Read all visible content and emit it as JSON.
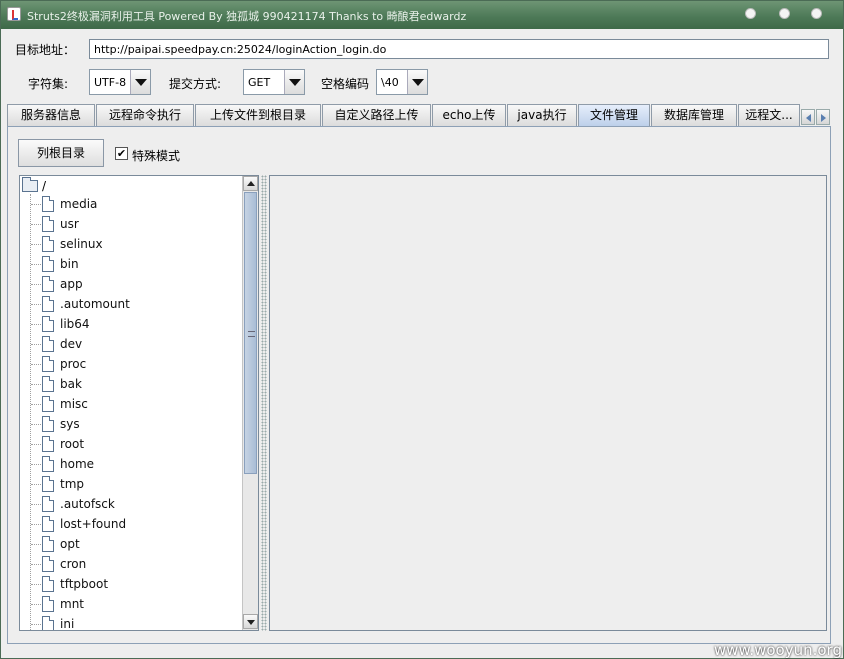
{
  "window": {
    "title": "Struts2终极漏洞利用工具   Powered By 独孤城 990421174 Thanks to 畸酿君edwardz"
  },
  "target": {
    "label": "目标地址：",
    "url": "http://paipai.speedpay.cn:25024/loginAction_login.do"
  },
  "options": {
    "charset_label": "字符集:",
    "charset_value": "UTF-8",
    "method_label": "提交方式:",
    "method_value": "GET",
    "space_label": "空格编码",
    "space_value": "\\40"
  },
  "tabs": [
    {
      "label": "服务器信息"
    },
    {
      "label": "远程命令执行"
    },
    {
      "label": "上传文件到根目录"
    },
    {
      "label": "自定义路径上传"
    },
    {
      "label": "echo上传"
    },
    {
      "label": "java执行"
    },
    {
      "label": "文件管理",
      "active": true
    },
    {
      "label": "数据库管理"
    },
    {
      "label": "远程文..."
    }
  ],
  "file_manager": {
    "list_root_button": "列根目录",
    "special_mode_checked": "✔",
    "special_mode_label": "特殊模式",
    "root": "/",
    "items": [
      "media",
      "usr",
      "selinux",
      "bin",
      "app",
      ".automount",
      "lib64",
      "dev",
      "proc",
      "bak",
      "misc",
      "sys",
      "root",
      "home",
      "tmp",
      ".autofsck",
      "lost+found",
      "opt",
      "cron",
      "tftpboot",
      "mnt",
      "ini"
    ]
  },
  "watermark": "www.wooyun.org"
}
